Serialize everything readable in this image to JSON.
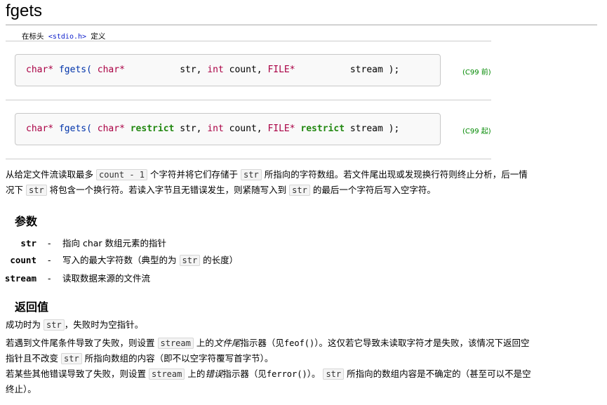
{
  "title": "fgets",
  "header": {
    "prefix": "在标头",
    "file": "<stdio.h>",
    "suffix": "定义"
  },
  "declarations": [
    {
      "ret": "char*",
      "name": "fgets(",
      "p1_type": "char*",
      "p1_restrict": "",
      "p1_name": "str,",
      "p2_type": "int",
      "p2_name": "count,",
      "p3_type": "FILE*",
      "p3_restrict": "",
      "p3_name": "stream );",
      "std": "(C99 前)"
    },
    {
      "ret": "char*",
      "name": "fgets(",
      "p1_type": "char*",
      "p1_restrict": "restrict",
      "p1_name": "str,",
      "p2_type": "int",
      "p2_name": "count,",
      "p3_type": "FILE*",
      "p3_restrict": "restrict",
      "p3_name": "stream );",
      "std": "(C99 起)"
    }
  ],
  "description": {
    "l1a": "从给定文件流读取最多",
    "l1_code1": "count - 1",
    "l1b": "个字符并将它们存储于",
    "l1_code2": "str",
    "l1c": "所指向的字符数组。若文件尾出现或发现换行符则终止分析，后一情",
    "l2a": "况下",
    "l2_code1": "str",
    "l2b": "将包含一个换行符。若读入字节且无错误发生，则紧随写入到",
    "l2_code2": "str",
    "l2c": "的最后一个字符后写入空字符。"
  },
  "params_heading": "参数",
  "params": [
    {
      "name": "str",
      "dash": "-",
      "d1": "指向 char 数组元素的指针",
      "code": "",
      "d2": ""
    },
    {
      "name": "count",
      "dash": "-",
      "d1": "写入的最大字符数（典型的为",
      "code": "str",
      "d2": "的长度）"
    },
    {
      "name": "stream",
      "dash": "-",
      "d1": "读取数据来源的文件流",
      "code": "",
      "d2": ""
    }
  ],
  "return_heading": "返回值",
  "return": {
    "p1a": "成功时为",
    "p1_code": "str",
    "p1b": "，失败时为空指针。",
    "p2a": "若遇到文件尾条件导致了失败，则设置",
    "p2_code": "stream",
    "p2b": "上的",
    "p2_em": "文件尾",
    "p2c": "指示器（见",
    "p2_fn": "feof()",
    "p2d": "）。这仅若它导致未读取字符才是失败，该情况下返回空",
    "p2e": "指针且不改变",
    "p2_code2": "str",
    "p2f": "所指向数组的内容（即不以空字符覆写首字节）。",
    "p3a": "若某些其他错误导致了失败，则设置",
    "p3_code": "stream",
    "p3b": "上的",
    "p3_em": "错误",
    "p3c": "指示器（见",
    "p3_fn": "ferror()",
    "p3d": "）。",
    "p3_code2": "str",
    "p3e": "所指向的数组内容是不确定的（甚至可以不是空",
    "p3f": "终止）。"
  }
}
